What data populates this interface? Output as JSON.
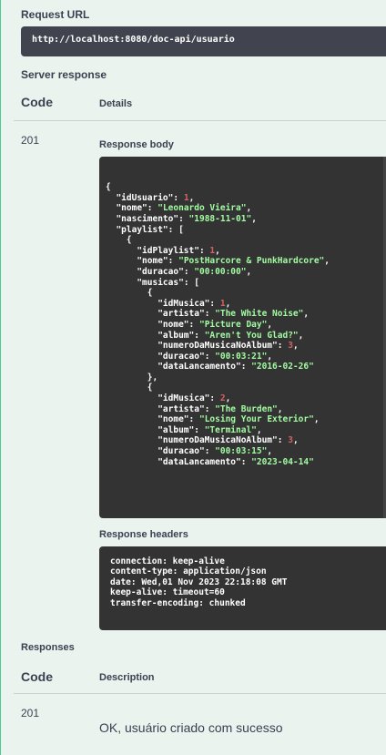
{
  "request_url": {
    "label": "Request URL",
    "value": "http://localhost:8080/doc-api/usuario"
  },
  "server_response": {
    "label": "Server response",
    "col_code": "Code",
    "col_details": "Details",
    "code": "201",
    "body_label": "Response body",
    "body_lines": [
      [
        [
          "p",
          "{"
        ]
      ],
      [
        [
          "p",
          "  "
        ],
        [
          "k",
          "\"idUsuario\""
        ],
        [
          "p",
          ": "
        ],
        [
          "n",
          "1"
        ],
        [
          "p",
          ","
        ]
      ],
      [
        [
          "p",
          "  "
        ],
        [
          "k",
          "\"nome\""
        ],
        [
          "p",
          ": "
        ],
        [
          "s",
          "\"Leonardo Vieira\""
        ],
        [
          "p",
          ","
        ]
      ],
      [
        [
          "p",
          "  "
        ],
        [
          "k",
          "\"nascimento\""
        ],
        [
          "p",
          ": "
        ],
        [
          "s",
          "\"1988-11-01\""
        ],
        [
          "p",
          ","
        ]
      ],
      [
        [
          "p",
          "  "
        ],
        [
          "k",
          "\"playlist\""
        ],
        [
          "p",
          ": ["
        ]
      ],
      [
        [
          "p",
          "    {"
        ]
      ],
      [
        [
          "p",
          "      "
        ],
        [
          "k",
          "\"idPlaylist\""
        ],
        [
          "p",
          ": "
        ],
        [
          "n",
          "1"
        ],
        [
          "p",
          ","
        ]
      ],
      [
        [
          "p",
          "      "
        ],
        [
          "k",
          "\"nome\""
        ],
        [
          "p",
          ": "
        ],
        [
          "s",
          "\"PostHarcore & PunkHardcore\""
        ],
        [
          "p",
          ","
        ]
      ],
      [
        [
          "p",
          "      "
        ],
        [
          "k",
          "\"duracao\""
        ],
        [
          "p",
          ": "
        ],
        [
          "s",
          "\"00:00:00\""
        ],
        [
          "p",
          ","
        ]
      ],
      [
        [
          "p",
          "      "
        ],
        [
          "k",
          "\"musicas\""
        ],
        [
          "p",
          ": ["
        ]
      ],
      [
        [
          "p",
          "        {"
        ]
      ],
      [
        [
          "p",
          "          "
        ],
        [
          "k",
          "\"idMusica\""
        ],
        [
          "p",
          ": "
        ],
        [
          "n",
          "1"
        ],
        [
          "p",
          ","
        ]
      ],
      [
        [
          "p",
          "          "
        ],
        [
          "k",
          "\"artista\""
        ],
        [
          "p",
          ": "
        ],
        [
          "s",
          "\"The White Noise\""
        ],
        [
          "p",
          ","
        ]
      ],
      [
        [
          "p",
          "          "
        ],
        [
          "k",
          "\"nome\""
        ],
        [
          "p",
          ": "
        ],
        [
          "s",
          "\"Picture Day\""
        ],
        [
          "p",
          ","
        ]
      ],
      [
        [
          "p",
          "          "
        ],
        [
          "k",
          "\"album\""
        ],
        [
          "p",
          ": "
        ],
        [
          "s",
          "\"Aren't You Glad?\""
        ],
        [
          "p",
          ","
        ]
      ],
      [
        [
          "p",
          "          "
        ],
        [
          "k",
          "\"numeroDaMusicaNoAlbum\""
        ],
        [
          "p",
          ": "
        ],
        [
          "n",
          "3"
        ],
        [
          "p",
          ","
        ]
      ],
      [
        [
          "p",
          "          "
        ],
        [
          "k",
          "\"duracao\""
        ],
        [
          "p",
          ": "
        ],
        [
          "s",
          "\"00:03:21\""
        ],
        [
          "p",
          ","
        ]
      ],
      [
        [
          "p",
          "          "
        ],
        [
          "k",
          "\"dataLancamento\""
        ],
        [
          "p",
          ": "
        ],
        [
          "s",
          "\"2016-02-26\""
        ]
      ],
      [
        [
          "p",
          "        },"
        ]
      ],
      [
        [
          "p",
          "        {"
        ]
      ],
      [
        [
          "p",
          "          "
        ],
        [
          "k",
          "\"idMusica\""
        ],
        [
          "p",
          ": "
        ],
        [
          "n",
          "2"
        ],
        [
          "p",
          ","
        ]
      ],
      [
        [
          "p",
          "          "
        ],
        [
          "k",
          "\"artista\""
        ],
        [
          "p",
          ": "
        ],
        [
          "s",
          "\"The Burden\""
        ],
        [
          "p",
          ","
        ]
      ],
      [
        [
          "p",
          "          "
        ],
        [
          "k",
          "\"nome\""
        ],
        [
          "p",
          ": "
        ],
        [
          "s",
          "\"Losing Your Exterior\""
        ],
        [
          "p",
          ","
        ]
      ],
      [
        [
          "p",
          "          "
        ],
        [
          "k",
          "\"album\""
        ],
        [
          "p",
          ": "
        ],
        [
          "s",
          "\"Terminal\""
        ],
        [
          "p",
          ","
        ]
      ],
      [
        [
          "p",
          "          "
        ],
        [
          "k",
          "\"numeroDaMusicaNoAlbum\""
        ],
        [
          "p",
          ": "
        ],
        [
          "n",
          "3"
        ],
        [
          "p",
          ","
        ]
      ],
      [
        [
          "p",
          "          "
        ],
        [
          "k",
          "\"duracao\""
        ],
        [
          "p",
          ": "
        ],
        [
          "s",
          "\"00:03:15\""
        ],
        [
          "p",
          ","
        ]
      ],
      [
        [
          "p",
          "          "
        ],
        [
          "k",
          "\"dataLancamento\""
        ],
        [
          "p",
          ": "
        ],
        [
          "s",
          "\"2023-04-14\""
        ]
      ]
    ],
    "headers_label": "Response headers",
    "headers_lines": [
      "connection: keep-alive",
      "content-type: application/json",
      "date: Wed,01 Nov 2023 22:18:08 GMT",
      "keep-alive: timeout=60",
      "transfer-encoding: chunked"
    ]
  },
  "responses": {
    "label": "Responses",
    "col_code": "Code",
    "col_description": "Description",
    "code": "201",
    "description": "OK, usuário criado com sucesso"
  }
}
